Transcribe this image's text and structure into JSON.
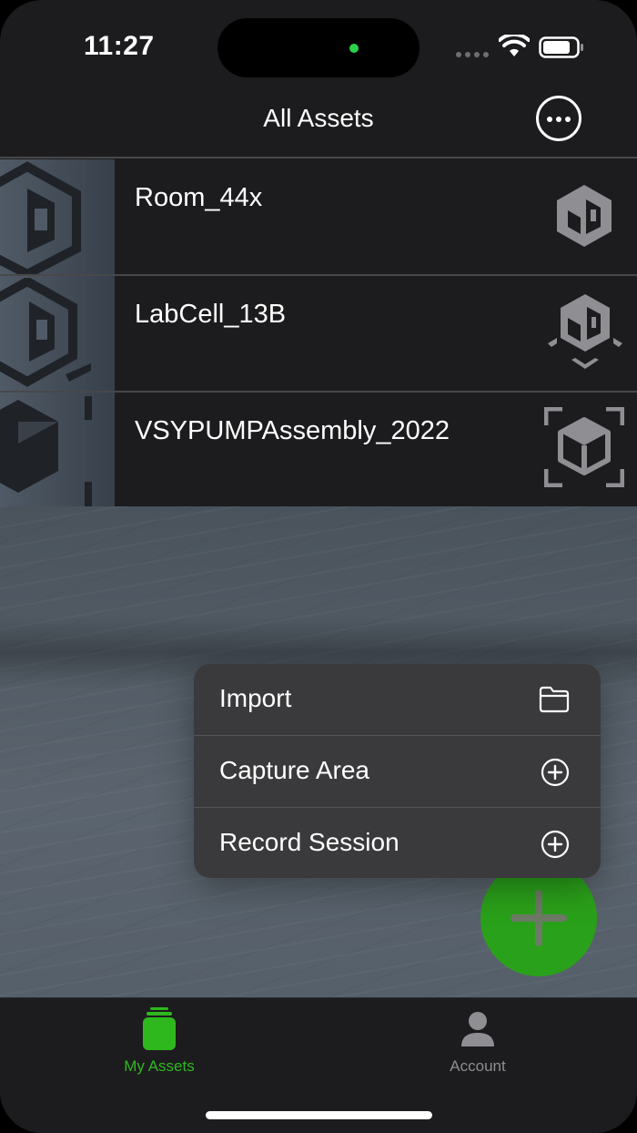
{
  "status_bar": {
    "time": "11:27"
  },
  "nav": {
    "title": "All Assets",
    "more_icon": "ellipsis-circle-icon"
  },
  "assets": [
    {
      "name": "Room_44x",
      "type_icon": "room-scan-icon"
    },
    {
      "name": "LabCell_13B",
      "type_icon": "area-capture-icon"
    },
    {
      "name": "VSYPUMPAssembly_2022",
      "type_icon": "object-capture-icon"
    }
  ],
  "menu": {
    "items": [
      {
        "label": "Import",
        "icon": "folder-icon"
      },
      {
        "label": "Capture Area",
        "icon": "plus-circle-icon"
      },
      {
        "label": "Record Session",
        "icon": "plus-circle-icon"
      }
    ]
  },
  "fab": {
    "icon": "plus-icon"
  },
  "tabs": [
    {
      "label": "My Assets",
      "icon": "stack-icon",
      "selected": true
    },
    {
      "label": "Account",
      "icon": "person-icon",
      "selected": false
    }
  ],
  "colors": {
    "accent": "#2aa11a",
    "tab_active": "#2eb81e",
    "tab_inactive": "#8e8e93",
    "background": "#1c1c1e"
  }
}
